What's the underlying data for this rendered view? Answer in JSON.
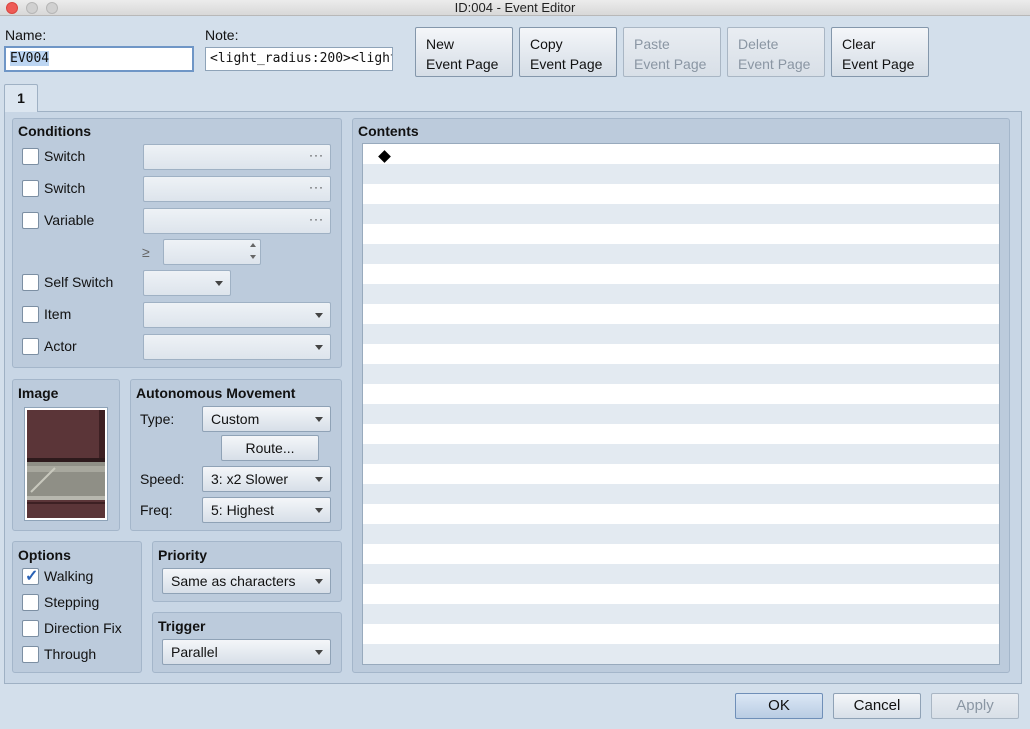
{
  "window": {
    "title": "ID:004 - Event Editor"
  },
  "header": {
    "name_label": "Name:",
    "name_value": "EV004",
    "note_label": "Note:",
    "note_value": "<light_radius:200><light_c",
    "buttons": [
      {
        "line1": "New",
        "line2": "Event Page"
      },
      {
        "line1": "Copy",
        "line2": "Event Page"
      },
      {
        "line1": "Paste",
        "line2": "Event Page"
      },
      {
        "line1": "Delete",
        "line2": "Event Page"
      },
      {
        "line1": "Clear",
        "line2": "Event Page"
      }
    ]
  },
  "tabs": [
    {
      "label": "1"
    }
  ],
  "conditions": {
    "title": "Conditions",
    "switch1": "Switch",
    "switch2": "Switch",
    "variable": "Variable",
    "gte": "≥",
    "self_switch": "Self Switch",
    "item": "Item",
    "actor": "Actor",
    "dots": "···"
  },
  "image": {
    "title": "Image"
  },
  "movement": {
    "title": "Autonomous Movement",
    "type_label": "Type:",
    "type_value": "Custom",
    "route_button": "Route...",
    "speed_label": "Speed:",
    "speed_value": "3: x2 Slower",
    "freq_label": "Freq:",
    "freq_value": "5: Highest"
  },
  "options": {
    "title": "Options",
    "walking": "Walking",
    "stepping": "Stepping",
    "direction_fix": "Direction Fix",
    "through": "Through",
    "walking_checked": true
  },
  "priority": {
    "title": "Priority",
    "value": "Same as characters"
  },
  "trigger": {
    "title": "Trigger",
    "value": "Parallel"
  },
  "contents": {
    "title": "Contents"
  },
  "footer": {
    "ok": "OK",
    "cancel": "Cancel",
    "apply": "Apply"
  }
}
